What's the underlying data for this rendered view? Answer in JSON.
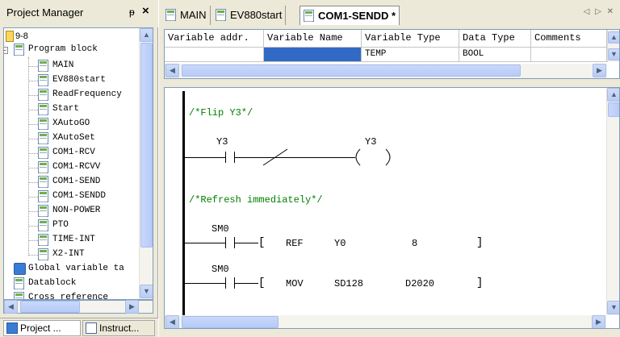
{
  "left_panel": {
    "title": "Project Manager",
    "pin_icon": "pin-icon",
    "close_label": "×",
    "tree_root": "9-8",
    "program_block": "Program block",
    "programs": [
      "MAIN",
      "EV880start",
      "ReadFrequency",
      "Start",
      "XAutoGO",
      "XAutoSet",
      "COM1-RCV",
      "COM1-RCVV",
      "COM1-SEND",
      "COM1-SENDD",
      "NON-POWER",
      "PTO",
      "TIME-INT",
      "X2-INT"
    ],
    "global_vars": "Global variable ta",
    "datablock": "Datablock",
    "truncated_item": "Cross reference",
    "bottom_tabs": [
      "Project ...",
      "Instruct..."
    ]
  },
  "tabs": [
    {
      "label": "MAIN",
      "icon": "program-icon"
    },
    {
      "label": "EV880start",
      "icon": "program-icon"
    },
    {
      "label": "COM1-SENDD *",
      "icon": "program-icon"
    }
  ],
  "nav_arrows": "◁ ▷ ✕",
  "var_table": {
    "headers": [
      "Variable addr.",
      "Variable Name",
      "Variable Type",
      "Data Type",
      "Comments"
    ],
    "row": [
      "",
      "",
      "TEMP",
      "BOOL",
      ""
    ]
  },
  "ladder": {
    "networks": [
      {
        "comment": "/*Flip Y3*/",
        "contact_label": "Y3",
        "coil_label": "Y3"
      },
      {
        "comment": "/*Refresh immediately*/",
        "rungs": [
          {
            "contact_label": "SM0",
            "instr": "REF",
            "op1": "Y0",
            "op2": "8"
          },
          {
            "contact_label": "SM0",
            "instr": "MOV",
            "op1": "SD128",
            "op2": "D2020"
          }
        ]
      }
    ],
    "bracket_open": "[",
    "bracket_close": "]"
  },
  "colors": {
    "accent": "#3169c6",
    "comment": "#008000",
    "panel": "#ece9d8"
  }
}
